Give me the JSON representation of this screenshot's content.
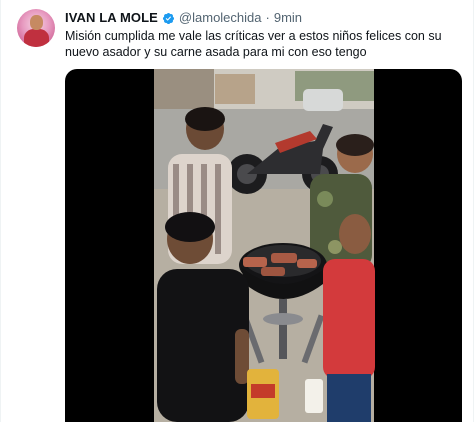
{
  "tweet": {
    "author_name": "IVAN LA MOLE",
    "author_handle": "@lamolechida",
    "separator": "·",
    "timestamp": "9min",
    "text": "Misión cumplida me vale las críticas ver a estos niños felices con su nuevo asador y su carne asada para mi con eso tengo",
    "verified": true
  },
  "media": {
    "type": "video"
  },
  "colors": {
    "primary_text": "#0f1419",
    "secondary_text": "#536471",
    "verified_badge": "#1d9bf0",
    "media_background": "#000000"
  },
  "icons": [
    "verified-icon"
  ]
}
